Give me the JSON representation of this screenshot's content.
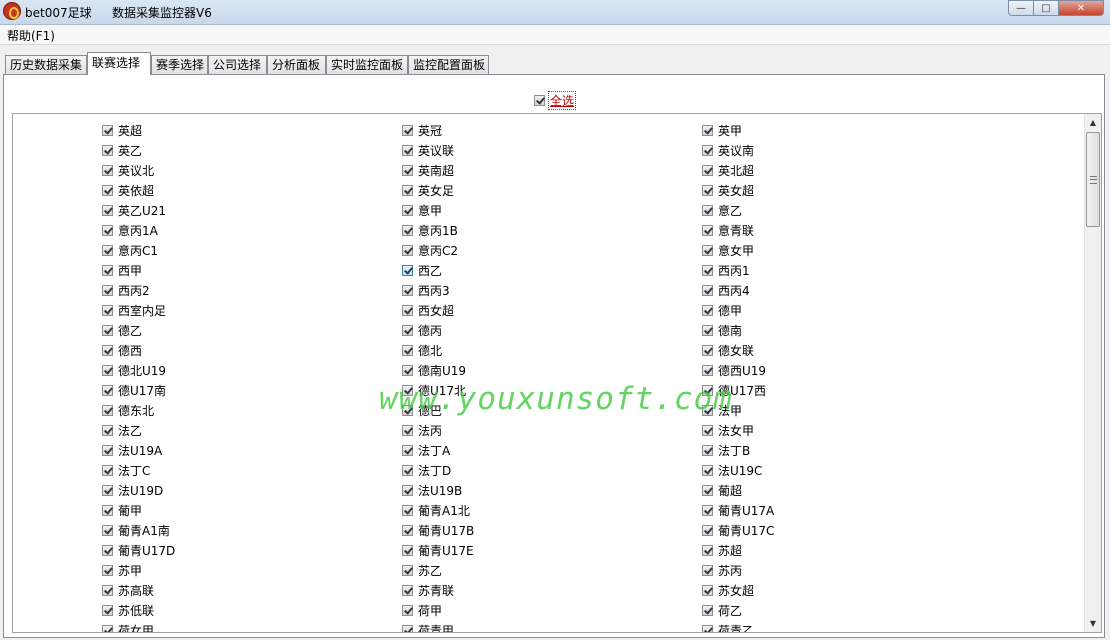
{
  "window": {
    "app_name": "bet007足球",
    "title": "数据采集监控器V6",
    "buttons": {
      "minimize": "—",
      "maximize": "□",
      "close": "✕"
    }
  },
  "menu": {
    "help": "帮助(F1)"
  },
  "tabs": [
    {
      "label": "历史数据采集"
    },
    {
      "label": "联赛选择",
      "active": true
    },
    {
      "label": "赛季选择"
    },
    {
      "label": "公司选择"
    },
    {
      "label": "分析面板"
    },
    {
      "label": "实时监控面板"
    },
    {
      "label": "监控配置面板"
    }
  ],
  "select_all": {
    "label": "全选",
    "checked": true
  },
  "columns": [
    [
      "英超",
      "英乙",
      "英议北",
      "英依超",
      "英乙U21",
      "意丙1A",
      "意丙C1",
      "西甲",
      "西丙2",
      "西室内足",
      "德乙",
      "德西",
      "德北U19",
      "德U17南",
      "德东北",
      "法乙",
      "法U19A",
      "法丁C",
      "法U19D",
      "葡甲",
      "葡青A1南",
      "葡青U17D",
      "苏甲",
      "苏高联",
      "苏低联",
      "荷女甲"
    ],
    [
      "英冠",
      "英议联",
      "英南超",
      "英女足",
      "意甲",
      "意丙1B",
      "意丙C2",
      "西乙",
      "西丙3",
      "西女超",
      "德丙",
      "德北",
      "德南U19",
      "德U17北",
      "德巴",
      "法丙",
      "法丁A",
      "法丁D",
      "法U19B",
      "葡青A1北",
      "葡青U17B",
      "葡青U17E",
      "苏乙",
      "苏青联",
      "荷甲",
      "荷青甲"
    ],
    [
      "英甲",
      "英议南",
      "英北超",
      "英女超",
      "意乙",
      "意青联",
      "意女甲",
      "西丙1",
      "西丙4",
      "德甲",
      "德南",
      "德女联",
      "德西U19",
      "德U17西",
      "法甲",
      "法女甲",
      "法丁B",
      "法U19C",
      "葡超",
      "葡青U17A",
      "葡青U17C",
      "苏超",
      "苏丙",
      "苏女超",
      "荷乙",
      "荷青乙"
    ]
  ],
  "watermark": "www.youxunsoft.com",
  "colors": {
    "select_all_text": "#c00000",
    "watermark": "#3ac83a"
  }
}
